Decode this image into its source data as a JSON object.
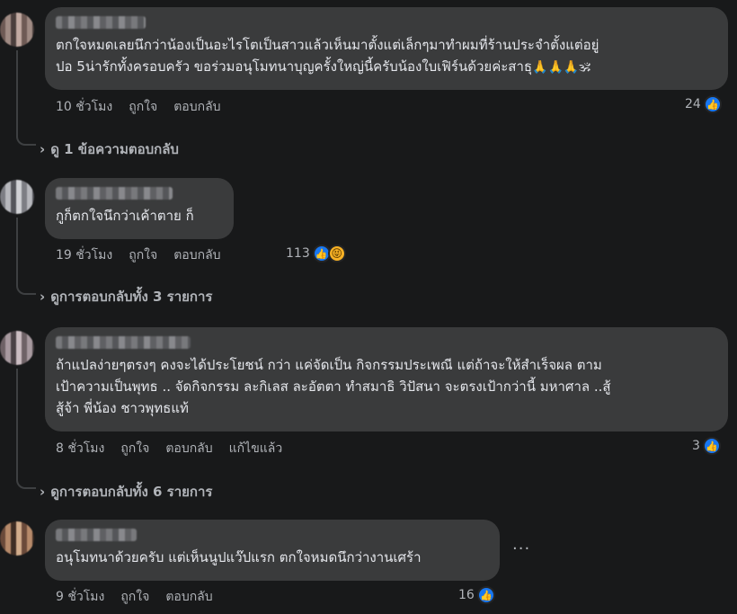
{
  "comments": [
    {
      "text_line1": "ตกใจหมดเลยนึกว่าน้องเป็นอะไรโตเป็นสาวแล้วเห็นมาตั้งแต่เล็กๆมาทำผมที่ร้านประจำตั้งแต่อยู่",
      "text_line2": "ปอ 5น่ารักทั้งครอบครัว ขอร่วมอนุโมทนาบุญครั้งใหญ่นี้ครับน้องใบเฟิร์นด้วยค่ะสาธุ",
      "emoji": "🙏🙏🙏🕉",
      "time": "10 ชั่วโมง",
      "like": "ถูกใจ",
      "reply": "ตอบกลับ",
      "reactions": "24",
      "view_replies": "ดู 1 ข้อความตอบกลับ"
    },
    {
      "text_line1": "กูก็ตกใจนึกว่าเค้าตาย ก็",
      "time": "19 ชั่วโมง",
      "like": "ถูกใจ",
      "reply": "ตอบกลับ",
      "reactions": "113",
      "view_replies": "ดูการตอบกลับทั้ง 3 รายการ"
    },
    {
      "text_line1": "ถ้าแปลง่ายๆตรงๆ คงจะได้ประโยชน์ กว่า แค่จัดเป็น กิจกรรมประเพณี แต่ถ้าจะให้สำเร็จผล ตาม",
      "text_line2": "เป้าความเป็นพุทธ .. จัดกิจกรรม ละกิเลส ละอัตตา ทำสมาธิ วิปัสนา จะตรงเป้ากว่านี้ มหาศาล ..สู้",
      "text_line3": "สู้จ้า พี่น้อง ชาวพุทธแท้",
      "time": "8 ชั่วโมง",
      "like": "ถูกใจ",
      "reply": "ตอบกลับ",
      "edited": "แก้ไขแล้ว",
      "reactions": "3",
      "view_replies": "ดูการตอบกลับทั้ง 6 รายการ"
    },
    {
      "text_line1": "อนุโมทนาด้วยครับ แต่เห็นนูปแว๊ปแรก ตกใจหมดนึกว่างานเศร้า",
      "time": "9 ชั่วโมง",
      "like": "ถูกใจ",
      "reply": "ตอบกลับ",
      "reactions": "16",
      "more": "···"
    }
  ]
}
